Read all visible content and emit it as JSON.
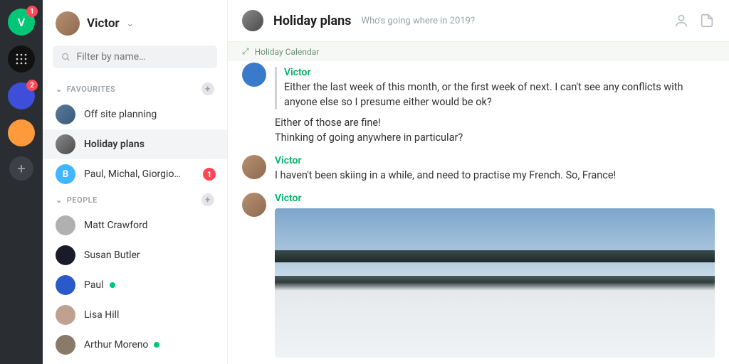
{
  "rail": {
    "items": [
      {
        "letter": "V",
        "bg": "#00c776",
        "badge": "1"
      },
      {
        "bg": "#1a1a1a",
        "pattern": true
      },
      {
        "bg": "#3d4fd8",
        "badge": "2"
      },
      {
        "bg": "#ff9a3c"
      }
    ]
  },
  "sidebar": {
    "user": "Victor",
    "search_placeholder": "Filter by name…",
    "sections": {
      "favourites": {
        "label": "FAVOURITES",
        "items": [
          {
            "label": "Off site planning"
          },
          {
            "label": "Holiday plans",
            "active": true
          },
          {
            "label": "Paul, Michal, Giorgio…",
            "letter": "B",
            "badge": "1"
          }
        ]
      },
      "people": {
        "label": "PEOPLE",
        "items": [
          {
            "label": "Matt Crawford"
          },
          {
            "label": "Susan Butler"
          },
          {
            "label": "Paul",
            "online": true
          },
          {
            "label": "Lisa Hill"
          },
          {
            "label": "Arthur Moreno",
            "online": true
          }
        ]
      }
    }
  },
  "header": {
    "title": "Holiday plans",
    "subtitle": "Who's going where in 2019?"
  },
  "banner": "Holiday Calendar",
  "messages": [
    {
      "author": "Victor",
      "quoted": "Either the last week of this month, or the first week of next. I can't see any conflicts with anyone else so I presume either would be ok?",
      "text_lines": [
        "Either of those are fine!",
        "Thinking of going anywhere in particular?"
      ],
      "avatar_partial": true
    },
    {
      "author": "Victor",
      "text_lines": [
        "I haven't been skiing in a while, and need to practise my French. So, France!"
      ]
    },
    {
      "author": "Victor",
      "image": true
    }
  ]
}
